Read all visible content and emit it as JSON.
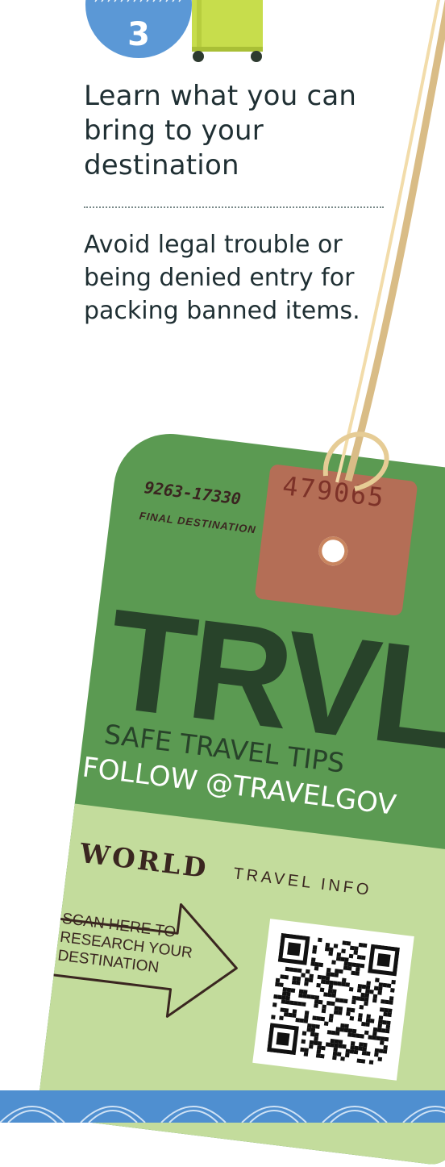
{
  "step": {
    "number": "3"
  },
  "section": {
    "heading": "Learn what you can bring to your destination",
    "body": "Avoid legal trouble or being denied entry for packing banned items."
  },
  "tag": {
    "code": "9263-17330",
    "final_destination": "FINAL DESTINATION",
    "patch_number": "479065",
    "brand": "TRVL",
    "tagline": "SAFE TRAVEL TIPS",
    "follow": "FOLLOW @TRAVELGOV",
    "world": "WORLD",
    "travel_info": "TRAVEL INFO",
    "scan_text": "SCAN HERE TO RESEARCH YOUR DESTINATION"
  },
  "colors": {
    "tag_green": "#5b9a52",
    "tag_light_green": "#c3dc9c",
    "patch_brown": "#b46e56",
    "badge_blue": "#5b98d6",
    "suitcase_lime": "#c7dd4c",
    "text_dark": "#1f2f33"
  }
}
